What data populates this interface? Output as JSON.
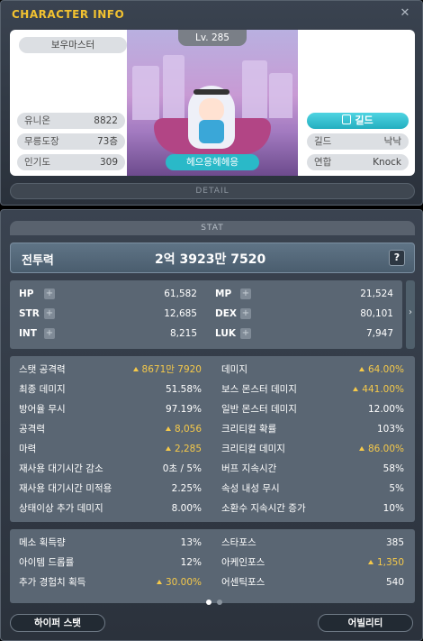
{
  "window": {
    "title": "CHARACTER INFO",
    "close_label": "✕"
  },
  "character": {
    "job": "보우마스터",
    "level": "Lv. 285",
    "name": "헤으응헤헤응",
    "stats": [
      {
        "label": "유니온",
        "value": "8822"
      },
      {
        "label": "무릉도장",
        "value": "73층"
      },
      {
        "label": "인기도",
        "value": "309"
      }
    ],
    "guild_button": "길드",
    "info": [
      {
        "label": "길드",
        "value": "낙낙"
      },
      {
        "label": "연합",
        "value": "Knock"
      }
    ],
    "detail_label": "DETAIL"
  },
  "stat": {
    "tab_label": "STAT",
    "power_label": "전투력",
    "power_value": "2억 3923만 7520",
    "help_label": "?",
    "base": [
      {
        "label": "HP",
        "value": "61,582"
      },
      {
        "label": "MP",
        "value": "21,524"
      },
      {
        "label": "STR",
        "value": "12,685"
      },
      {
        "label": "DEX",
        "value": "80,101"
      },
      {
        "label": "INT",
        "value": "8,215"
      },
      {
        "label": "LUK",
        "value": "7,947"
      }
    ],
    "scroll_arrow": "›",
    "detail": [
      {
        "label": "스탯 공격력",
        "value": "8671만 7920",
        "up": true
      },
      {
        "label": "데미지",
        "value": "64.00%",
        "up": true
      },
      {
        "label": "최종 데미지",
        "value": "51.58%",
        "up": false
      },
      {
        "label": "보스 몬스터 데미지",
        "value": "441.00%",
        "up": true
      },
      {
        "label": "방어율 무시",
        "value": "97.19%",
        "up": false
      },
      {
        "label": "일반 몬스터 데미지",
        "value": "12.00%",
        "up": false
      },
      {
        "label": "공격력",
        "value": "8,056",
        "up": true
      },
      {
        "label": "크리티컬 확률",
        "value": "103%",
        "up": false
      },
      {
        "label": "마력",
        "value": "2,285",
        "up": true
      },
      {
        "label": "크리티컬 데미지",
        "value": "86.00%",
        "up": true
      },
      {
        "label": "재사용 대기시간 감소",
        "value": "0초 / 5%",
        "up": false
      },
      {
        "label": "버프 지속시간",
        "value": "58%",
        "up": false
      },
      {
        "label": "재사용 대기시간 미적용",
        "value": "2.25%",
        "up": false
      },
      {
        "label": "속성 내성 무시",
        "value": "5%",
        "up": false
      },
      {
        "label": "상태이상 추가 데미지",
        "value": "8.00%",
        "up": false
      },
      {
        "label": "소환수 지속시간 증가",
        "value": "10%",
        "up": false
      }
    ],
    "extra": [
      {
        "label": "메소 획득량",
        "value": "13%",
        "up": false
      },
      {
        "label": "스타포스",
        "value": "385",
        "up": false
      },
      {
        "label": "아이템 드롭률",
        "value": "12%",
        "up": false
      },
      {
        "label": "아케인포스",
        "value": "1,350",
        "up": true
      },
      {
        "label": "추가 경험치 획득",
        "value": "30.00%",
        "up": true
      },
      {
        "label": "어센틱포스",
        "value": "540",
        "up": false
      }
    ],
    "hyper_button": "하이퍼 스탯",
    "ability_button": "어빌리티"
  }
}
